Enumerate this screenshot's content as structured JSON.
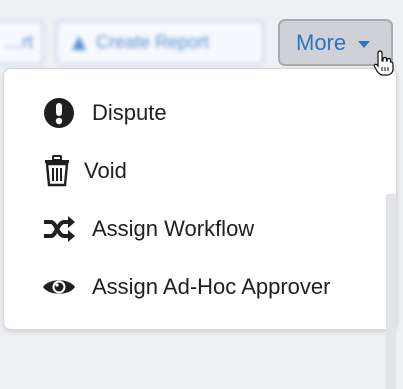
{
  "toolbar": {
    "left_button_label": "…rt",
    "create_report_label": "Create Report",
    "more_label": "More"
  },
  "menu": {
    "items": [
      {
        "label": "Dispute",
        "icon": "exclamation-circle-icon"
      },
      {
        "label": "Void",
        "icon": "trash-icon"
      },
      {
        "label": "Assign Workflow",
        "icon": "shuffle-icon"
      },
      {
        "label": "Assign Ad-Hoc Approver",
        "icon": "eye-icon"
      }
    ]
  },
  "colors": {
    "accent": "#2f74c3",
    "more_bg": "#cfd1d6",
    "text": "#202020"
  }
}
